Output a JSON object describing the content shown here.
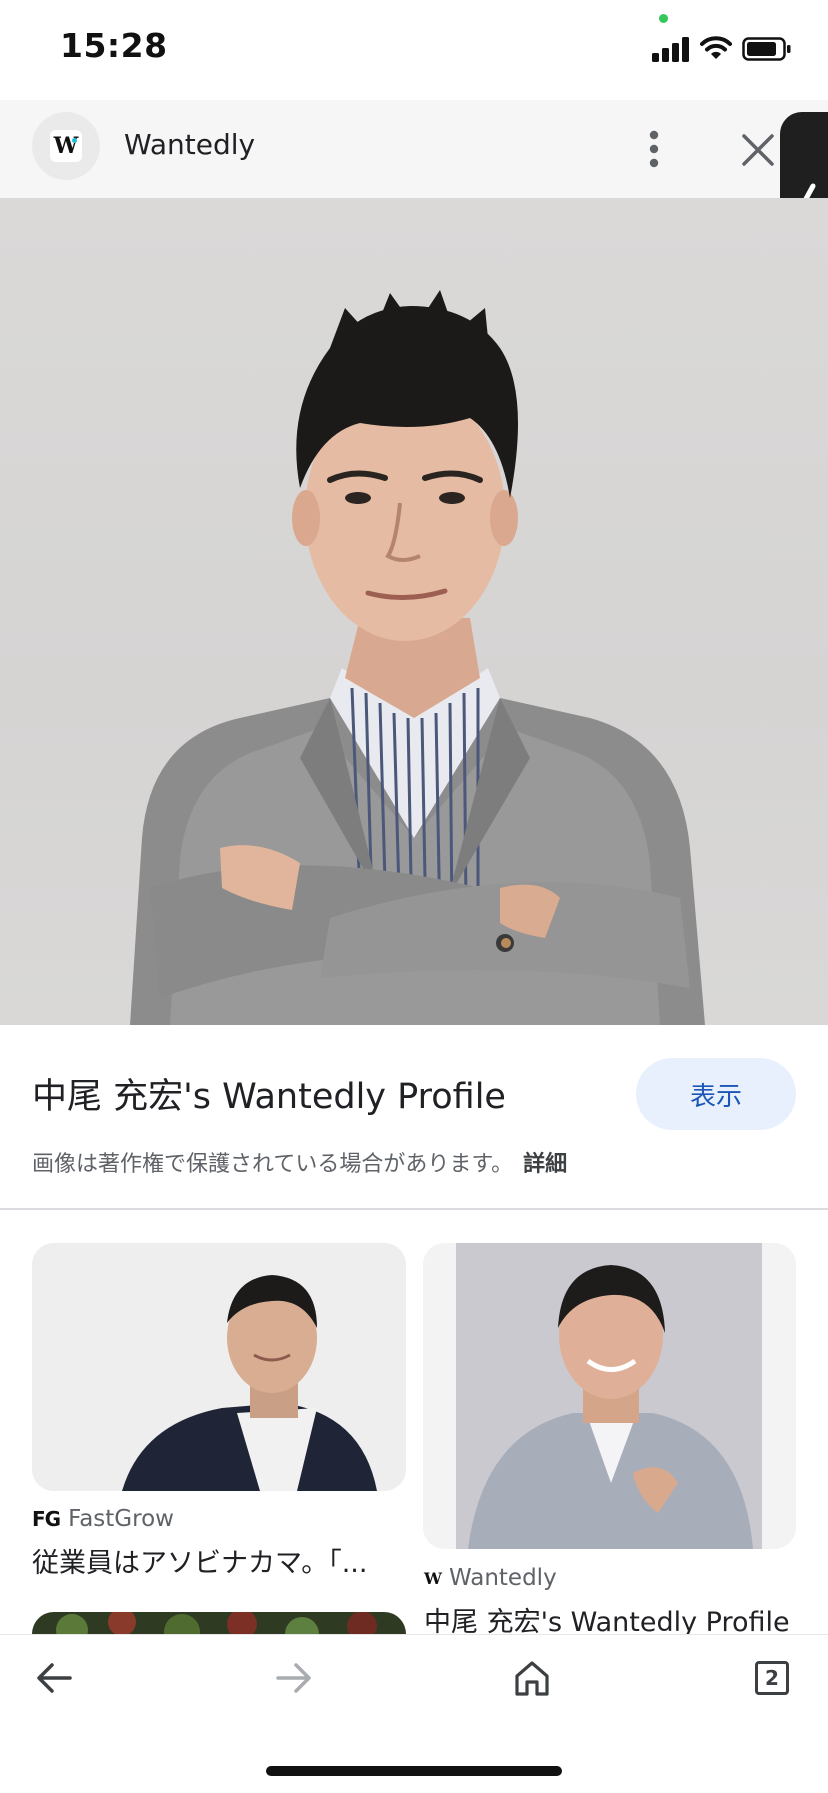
{
  "status_bar": {
    "time": "15:28"
  },
  "header": {
    "site_name": "Wantedly",
    "site_logo_letter": "W"
  },
  "result": {
    "title": "中尾 充宏's Wantedly Profile",
    "visit_label": "表示",
    "copyright_notice": "画像は著作権で保護されている場合があります。",
    "details_link": "詳細"
  },
  "related": [
    {
      "source_logo": "FG",
      "source_name": "FastGrow",
      "title": "従業員はアソビナカマ。「..."
    },
    {
      "source_logo": "W",
      "source_name": "Wantedly",
      "title": "中尾 充宏's Wantedly Profile"
    }
  ],
  "toolbar": {
    "tab_count": "2"
  },
  "colors": {
    "accent": "#1a56b5",
    "visit_bg": "#e8f0fe",
    "wantedly_dot": "#21bddb"
  }
}
